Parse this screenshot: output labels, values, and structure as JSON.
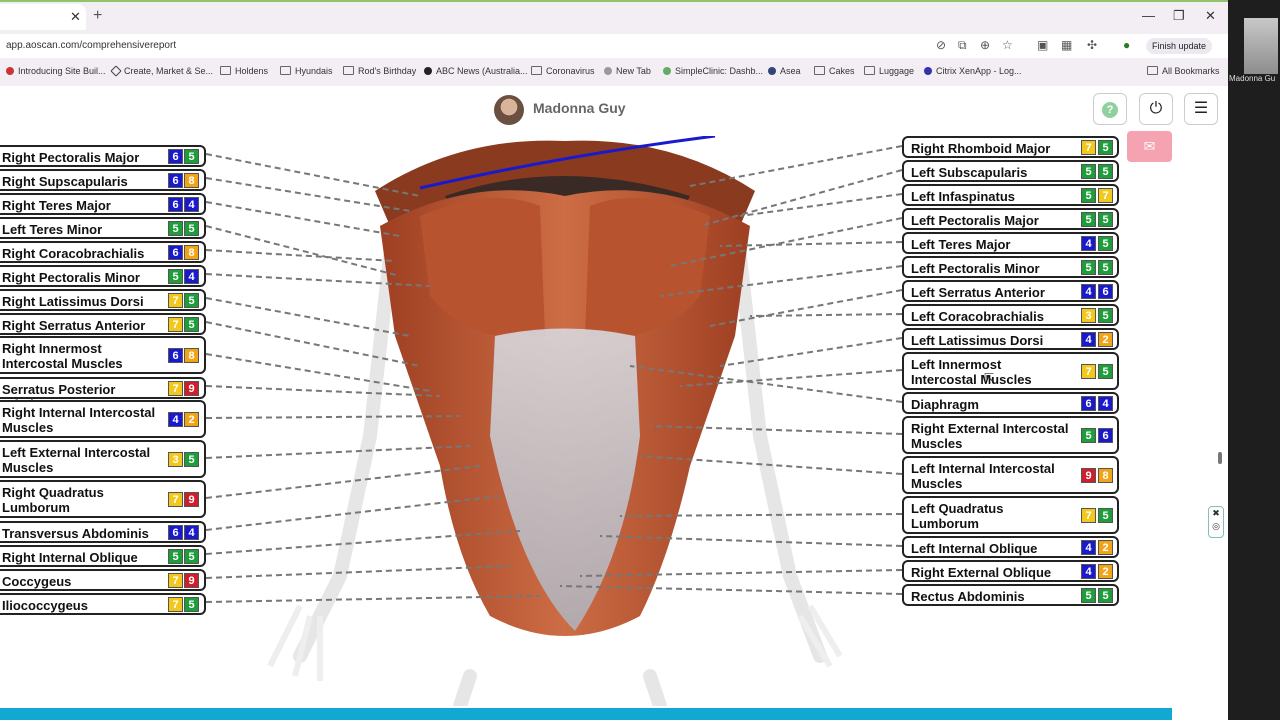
{
  "browser": {
    "url": "app.aoscan.com/comprehensivereport",
    "finish_update": "Finish update",
    "bookmarks": [
      "Introducing Site Buil...",
      "Create, Market & Se...",
      "Holdens",
      "Hyundais",
      "Rod's Birthday",
      "ABC News (Australia...",
      "Coronavirus",
      "New Tab",
      "SimpleClinic: Dashb...",
      "Asea",
      "Cakes",
      "Luggage",
      "Citrix XenApp - Log..."
    ],
    "all_bookmarks": "All Bookmarks",
    "meeting_name": "Madonna Gu"
  },
  "header": {
    "user_name": "Madonna Guy",
    "help_label": "?"
  },
  "colors": {
    "blue": "#1a1acc",
    "green": "#1e9e3a",
    "yellow": "#f2c81d",
    "orange": "#f2a419",
    "red": "#d01f2a"
  },
  "left_labels": [
    {
      "name": "Right Pectoralis Major",
      "v1": "6",
      "v2": "5",
      "c1": "blue",
      "c2": "green"
    },
    {
      "name": "Right Supscapularis",
      "v1": "6",
      "v2": "8",
      "c1": "blue",
      "c2": "orange"
    },
    {
      "name": "Right Teres Major",
      "v1": "6",
      "v2": "4",
      "c1": "blue",
      "c2": "blue"
    },
    {
      "name": "Left Teres Minor",
      "v1": "5",
      "v2": "5",
      "c1": "green",
      "c2": "green"
    },
    {
      "name": "Right Coracobrachialis",
      "v1": "6",
      "v2": "8",
      "c1": "blue",
      "c2": "orange"
    },
    {
      "name": "Right Pectoralis Minor",
      "v1": "5",
      "v2": "4",
      "c1": "green",
      "c2": "blue"
    },
    {
      "name": "Right Latissimus Dorsi",
      "v1": "7",
      "v2": "5",
      "c1": "yellow",
      "c2": "green"
    },
    {
      "name": "Right Serratus Anterior",
      "v1": "7",
      "v2": "5",
      "c1": "yellow",
      "c2": "green"
    },
    {
      "name": "Right Innermost Intercostal Muscles",
      "v1": "6",
      "v2": "8",
      "c1": "blue",
      "c2": "orange"
    },
    {
      "name": "Serratus Posterior Inferior",
      "v1": "7",
      "v2": "9",
      "c1": "yellow",
      "c2": "red"
    },
    {
      "name": "Right Internal Intercostal Muscles",
      "v1": "4",
      "v2": "2",
      "c1": "blue",
      "c2": "orange"
    },
    {
      "name": "Left External Intercostal Muscles",
      "v1": "3",
      "v2": "5",
      "c1": "yellow",
      "c2": "green"
    },
    {
      "name": "Right Quadratus Lumborum",
      "v1": "7",
      "v2": "9",
      "c1": "yellow",
      "c2": "red"
    },
    {
      "name": "Transversus Abdominis",
      "v1": "6",
      "v2": "4",
      "c1": "blue",
      "c2": "blue"
    },
    {
      "name": "Right Internal Oblique",
      "v1": "5",
      "v2": "5",
      "c1": "green",
      "c2": "green"
    },
    {
      "name": "Coccygeus",
      "v1": "7",
      "v2": "9",
      "c1": "yellow",
      "c2": "red"
    },
    {
      "name": "Iliococcygeus",
      "v1": "7",
      "v2": "5",
      "c1": "yellow",
      "c2": "green"
    }
  ],
  "right_labels": [
    {
      "name": "Right Rhomboid Major",
      "v1": "7",
      "v2": "5",
      "c1": "yellow",
      "c2": "green"
    },
    {
      "name": "Left Subscapularis",
      "v1": "5",
      "v2": "5",
      "c1": "green",
      "c2": "green"
    },
    {
      "name": "Left Infaspinatus",
      "v1": "5",
      "v2": "7",
      "c1": "green",
      "c2": "yellow"
    },
    {
      "name": "Left Pectoralis Major",
      "v1": "5",
      "v2": "5",
      "c1": "green",
      "c2": "green"
    },
    {
      "name": "Left Teres Major",
      "v1": "4",
      "v2": "5",
      "c1": "blue",
      "c2": "green"
    },
    {
      "name": "Left Pectoralis Minor",
      "v1": "5",
      "v2": "5",
      "c1": "green",
      "c2": "green"
    },
    {
      "name": "Left Serratus Anterior",
      "v1": "4",
      "v2": "6",
      "c1": "blue",
      "c2": "blue"
    },
    {
      "name": "Left Coracobrachialis",
      "v1": "3",
      "v2": "5",
      "c1": "yellow",
      "c2": "green"
    },
    {
      "name": "Left Latissimus Dorsi",
      "v1": "4",
      "v2": "2",
      "c1": "blue",
      "c2": "orange"
    },
    {
      "name": "Left Innermost Intercostal Muscles",
      "v1": "7",
      "v2": "5",
      "c1": "yellow",
      "c2": "green"
    },
    {
      "name": "Diaphragm",
      "v1": "6",
      "v2": "4",
      "c1": "blue",
      "c2": "blue"
    },
    {
      "name": "Right External Intercostal Muscles",
      "v1": "5",
      "v2": "6",
      "c1": "green",
      "c2": "blue"
    },
    {
      "name": "Left Internal Intercostal Muscles",
      "v1": "9",
      "v2": "8",
      "c1": "red",
      "c2": "orange"
    },
    {
      "name": "Left Quadratus Lumborum",
      "v1": "7",
      "v2": "5",
      "c1": "yellow",
      "c2": "green"
    },
    {
      "name": "Left Internal Oblique",
      "v1": "4",
      "v2": "2",
      "c1": "blue",
      "c2": "orange"
    },
    {
      "name": "Right External Oblique",
      "v1": "4",
      "v2": "2",
      "c1": "blue",
      "c2": "orange"
    },
    {
      "name": "Rectus Abdominis",
      "v1": "5",
      "v2": "5",
      "c1": "green",
      "c2": "green"
    }
  ]
}
